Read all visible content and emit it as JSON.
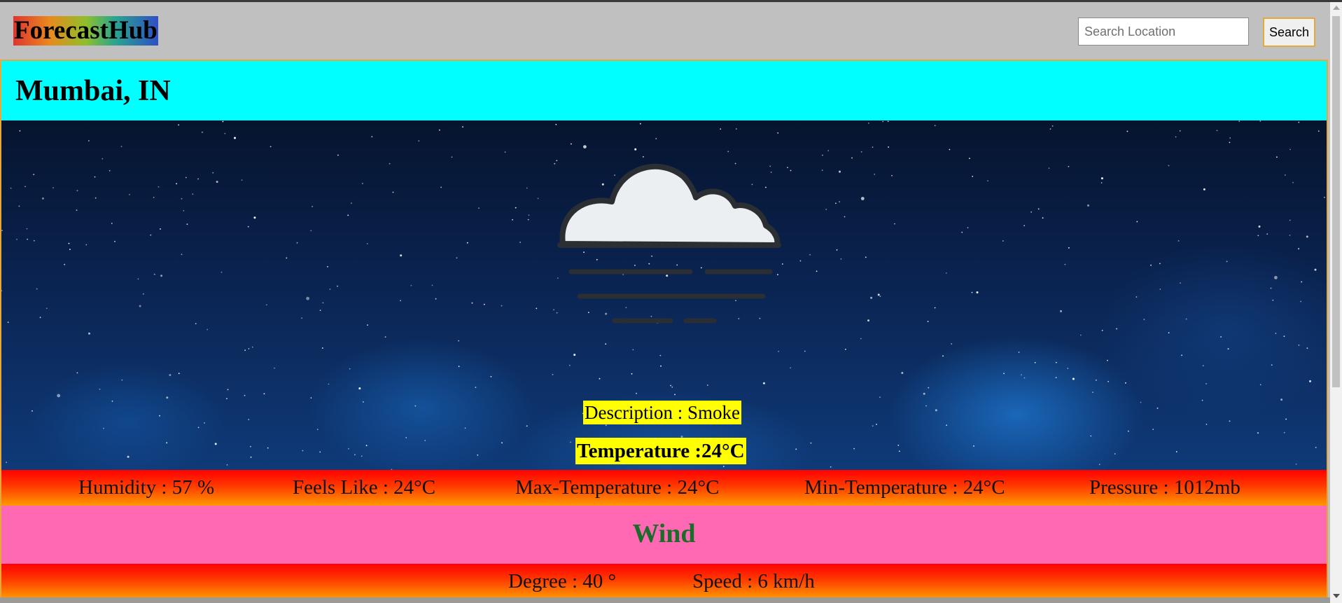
{
  "navbar": {
    "logo": "ForecastHub",
    "search_placeholder": "Search Location",
    "search_value": "",
    "search_button": "Search"
  },
  "location": {
    "city": "Mumbai, IN"
  },
  "current": {
    "icon": "fog-cloud-icon",
    "description": "Description : Smoke",
    "temperature": "Temperature :24°C"
  },
  "stats": {
    "humidity": "Humidity : 57 %",
    "feels_like": "Feels Like : 24°C",
    "max_temp": "Max-Temperature : 24°C",
    "min_temp": "Min-Temperature : 24°C",
    "pressure": "Pressure : 1012mb"
  },
  "wind": {
    "title": "Wind",
    "degree": "Degree : 40 °",
    "speed": "Speed : 6 km/h"
  },
  "colors": {
    "city_band": "#00ffff",
    "wind_band": "#ff69b4",
    "highlight": "#ffff00",
    "wind_title": "#1b6b2a",
    "accent_border": "#e6a83a"
  }
}
